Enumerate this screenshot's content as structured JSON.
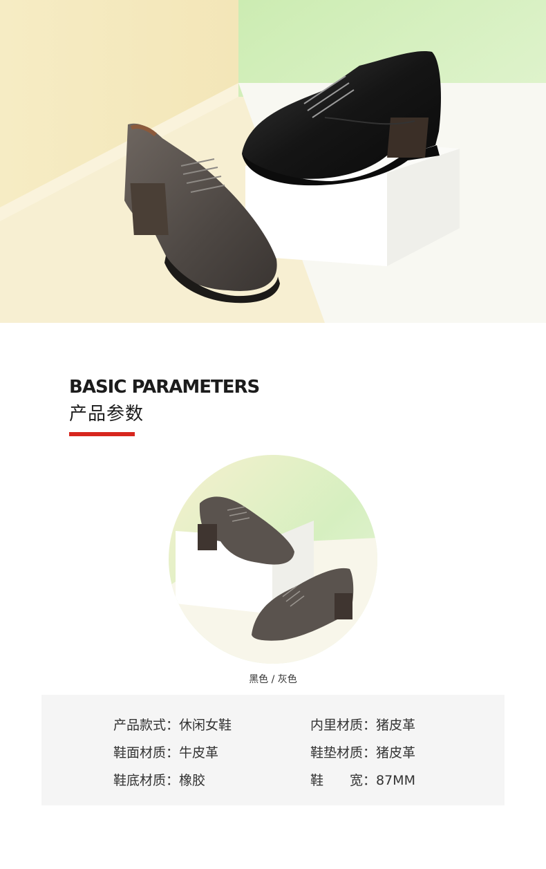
{
  "section": {
    "title_en": "BASIC PARAMETERS",
    "title_cn": "产品参数",
    "accent_color": "#d7261e"
  },
  "colors_caption": "黑色 / 灰色",
  "params": {
    "style": "产品款式：休闲女鞋",
    "upper": "鞋面材质：牛皮革",
    "sole": "鞋底材质：橡胶",
    "lining": "内里材质：猪皮革",
    "insole": "鞋垫材质：猪皮革",
    "width": "鞋　　宽：87MM"
  },
  "images": {
    "hero": "hero-shoes-photo",
    "circle": "circle-shoes-photo"
  }
}
